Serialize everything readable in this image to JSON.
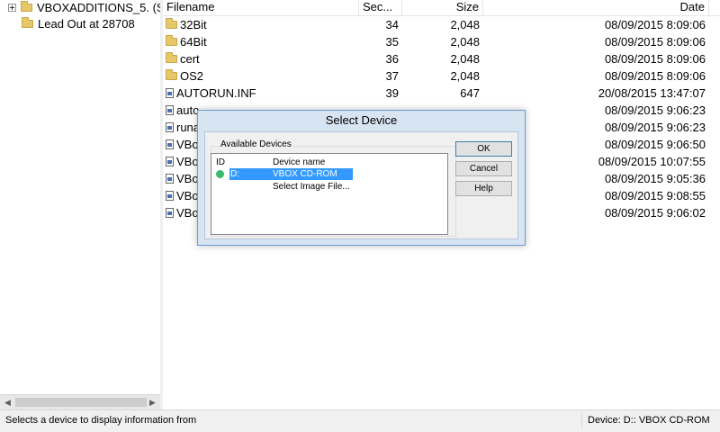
{
  "tree": {
    "items": [
      {
        "label": "VBOXADDITIONS_5. (S",
        "icon": "folder-icon",
        "expander": true
      },
      {
        "label": "Lead Out at 28708",
        "icon": "folder-icon",
        "expander": false
      }
    ]
  },
  "file_list": {
    "columns": [
      "Filename",
      "Sec...",
      "Size",
      "Date"
    ],
    "rows": [
      {
        "name": "32Bit",
        "icon": "folder-icon",
        "sector": "34",
        "size": "2,048",
        "date": "08/09/2015  8:09:06"
      },
      {
        "name": "64Bit",
        "icon": "folder-icon",
        "sector": "35",
        "size": "2,048",
        "date": "08/09/2015  8:09:06"
      },
      {
        "name": "cert",
        "icon": "folder-icon",
        "sector": "36",
        "size": "2,048",
        "date": "08/09/2015  8:09:06"
      },
      {
        "name": "OS2",
        "icon": "folder-icon",
        "sector": "37",
        "size": "2,048",
        "date": "08/09/2015  8:09:06"
      },
      {
        "name": "AUTORUN.INF",
        "icon": "file-icon",
        "sector": "39",
        "size": "647",
        "date": "20/08/2015 13:47:07"
      },
      {
        "name": "auto",
        "icon": "file-icon",
        "sector": "",
        "size": "",
        "date": "08/09/2015  9:06:23"
      },
      {
        "name": "runa",
        "icon": "file-icon",
        "sector": "",
        "size": "",
        "date": "08/09/2015  9:06:23"
      },
      {
        "name": "VBo",
        "icon": "file-icon",
        "sector": "",
        "size": "",
        "date": "08/09/2015  9:06:50"
      },
      {
        "name": "VBo",
        "icon": "file-icon",
        "sector": "",
        "size": "",
        "date": "08/09/2015 10:07:55"
      },
      {
        "name": "VBo",
        "icon": "file-icon",
        "sector": "",
        "size": "",
        "date": "08/09/2015  9:05:36"
      },
      {
        "name": "VBo",
        "icon": "file-icon",
        "sector": "",
        "size": "",
        "date": "08/09/2015  9:08:55"
      },
      {
        "name": "VBo",
        "icon": "file-icon",
        "sector": "",
        "size": "",
        "date": "08/09/2015  9:06:02"
      }
    ]
  },
  "dialog": {
    "title": "Select Device",
    "group_label": "Available Devices",
    "list_headers": {
      "id": "ID",
      "name": "Device name"
    },
    "devices": [
      {
        "id": "D:",
        "name": "VBOX CD-ROM",
        "selected": true,
        "status_color": "#3bb96f"
      },
      {
        "id": "",
        "name": "Select Image File...",
        "selected": false
      }
    ],
    "buttons": {
      "ok": "OK",
      "cancel": "Cancel",
      "help": "Help"
    }
  },
  "status": {
    "left": "Selects a device to display information from",
    "right": "Device: D:: VBOX CD-ROM"
  },
  "colors": {
    "selection": "#3399ff",
    "dialog_frame": "#d7e4f2"
  }
}
